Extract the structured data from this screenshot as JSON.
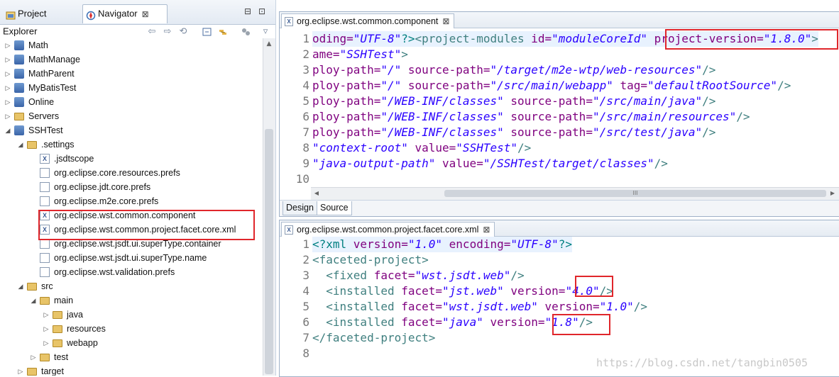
{
  "navigator": {
    "tabs": [
      {
        "label": "Project Explorer",
        "icon": "project-explorer-icon"
      },
      {
        "label": "Navigator",
        "icon": "navigator-icon",
        "close": "⊠"
      }
    ],
    "window_controls": {
      "minimize": "⊟",
      "maximize": "⊡"
    },
    "toolbar_icons": [
      "back-icon",
      "forward-icon",
      "go-into-icon",
      "collapse-all-icon",
      "link-with-editor-icon",
      "working-sets-icon",
      "view-menu-icon"
    ],
    "tree": [
      {
        "label": "Math",
        "depth": 0,
        "type": "project",
        "expander": "▷"
      },
      {
        "label": "MathManage",
        "depth": 0,
        "type": "project",
        "expander": "▷"
      },
      {
        "label": "MathParent",
        "depth": 0,
        "type": "project",
        "expander": "▷"
      },
      {
        "label": "MyBatisTest",
        "depth": 0,
        "type": "project",
        "expander": "▷"
      },
      {
        "label": "Online",
        "depth": 0,
        "type": "project",
        "expander": "▷"
      },
      {
        "label": "Servers",
        "depth": 0,
        "type": "folder",
        "expander": "▷"
      },
      {
        "label": "SSHTest",
        "depth": 0,
        "type": "project",
        "expander": "◢"
      },
      {
        "label": ".settings",
        "depth": 1,
        "type": "folder",
        "expander": "◢"
      },
      {
        "label": ".jsdtscope",
        "depth": 2,
        "type": "xmlfile",
        "expander": ""
      },
      {
        "label": "org.eclipse.core.resources.prefs",
        "depth": 2,
        "type": "file",
        "expander": ""
      },
      {
        "label": "org.eclipse.jdt.core.prefs",
        "depth": 2,
        "type": "file",
        "expander": ""
      },
      {
        "label": "org.eclipse.m2e.core.prefs",
        "depth": 2,
        "type": "file",
        "expander": ""
      },
      {
        "label": "org.eclipse.wst.common.component",
        "depth": 2,
        "type": "xmlfile",
        "expander": ""
      },
      {
        "label": "org.eclipse.wst.common.project.facet.core.xml",
        "depth": 2,
        "type": "xmlfile",
        "expander": ""
      },
      {
        "label": "org.eclipse.wst.jsdt.ui.superType.container",
        "depth": 2,
        "type": "file",
        "expander": ""
      },
      {
        "label": "org.eclipse.wst.jsdt.ui.superType.name",
        "depth": 2,
        "type": "file",
        "expander": ""
      },
      {
        "label": "org.eclipse.wst.validation.prefs",
        "depth": 2,
        "type": "file",
        "expander": ""
      },
      {
        "label": "src",
        "depth": 1,
        "type": "folder",
        "expander": "◢"
      },
      {
        "label": "main",
        "depth": 2,
        "type": "folder",
        "expander": "◢"
      },
      {
        "label": "java",
        "depth": 3,
        "type": "folder",
        "expander": "▷"
      },
      {
        "label": "resources",
        "depth": 3,
        "type": "folder",
        "expander": "▷"
      },
      {
        "label": "webapp",
        "depth": 3,
        "type": "folder",
        "expander": "▷"
      },
      {
        "label": "test",
        "depth": 2,
        "type": "folder",
        "expander": "▷"
      },
      {
        "label": "target",
        "depth": 1,
        "type": "folder",
        "expander": "▷"
      }
    ]
  },
  "editor1": {
    "tab_label": "org.eclipse.wst.common.component",
    "tab_close": "⊠",
    "line_numbers": [
      "1",
      "2",
      "3",
      "4",
      "5",
      "6",
      "7",
      "8",
      "9",
      "10"
    ],
    "lines": [
      [
        {
          "t": "oding=",
          "c": "attr"
        },
        {
          "t": "\"UTF-8\"",
          "c": "val"
        },
        {
          "t": "?>",
          "c": "pi"
        },
        {
          "t": "<project-modules ",
          "c": "tag"
        },
        {
          "t": "id=",
          "c": "attr"
        },
        {
          "t": "\"moduleCoreId\"",
          "c": "val"
        },
        {
          "t": " ",
          "c": "plain"
        },
        {
          "t": "project-version=",
          "c": "attr"
        },
        {
          "t": "\"1.8.0\"",
          "c": "val"
        },
        {
          "t": ">",
          "c": "tag"
        }
      ],
      [
        {
          "t": "ame=",
          "c": "attr"
        },
        {
          "t": "\"SSHTest\"",
          "c": "val"
        },
        {
          "t": ">",
          "c": "tag"
        }
      ],
      [
        {
          "t": "ploy-path=",
          "c": "attr"
        },
        {
          "t": "\"/\"",
          "c": "val"
        },
        {
          "t": " source-path=",
          "c": "attr"
        },
        {
          "t": "\"/target/m2e-wtp/web-resources\"",
          "c": "val"
        },
        {
          "t": "/>",
          "c": "tag"
        }
      ],
      [
        {
          "t": "ploy-path=",
          "c": "attr"
        },
        {
          "t": "\"/\"",
          "c": "val"
        },
        {
          "t": " source-path=",
          "c": "attr"
        },
        {
          "t": "\"/src/main/webapp\"",
          "c": "val"
        },
        {
          "t": " tag=",
          "c": "attr"
        },
        {
          "t": "\"defaultRootSource\"",
          "c": "val"
        },
        {
          "t": "/>",
          "c": "tag"
        }
      ],
      [
        {
          "t": "ploy-path=",
          "c": "attr"
        },
        {
          "t": "\"/WEB-INF/classes\"",
          "c": "val"
        },
        {
          "t": " source-path=",
          "c": "attr"
        },
        {
          "t": "\"/src/main/java\"",
          "c": "val"
        },
        {
          "t": "/>",
          "c": "tag"
        }
      ],
      [
        {
          "t": "ploy-path=",
          "c": "attr"
        },
        {
          "t": "\"/WEB-INF/classes\"",
          "c": "val"
        },
        {
          "t": " source-path=",
          "c": "attr"
        },
        {
          "t": "\"/src/main/resources\"",
          "c": "val"
        },
        {
          "t": "/>",
          "c": "tag"
        }
      ],
      [
        {
          "t": "ploy-path=",
          "c": "attr"
        },
        {
          "t": "\"/WEB-INF/classes\"",
          "c": "val"
        },
        {
          "t": " source-path=",
          "c": "attr"
        },
        {
          "t": "\"/src/test/java\"",
          "c": "val"
        },
        {
          "t": "/>",
          "c": "tag"
        }
      ],
      [
        {
          "t": "\"context-root\"",
          "c": "val"
        },
        {
          "t": " value=",
          "c": "attr"
        },
        {
          "t": "\"SSHTest\"",
          "c": "val"
        },
        {
          "t": "/>",
          "c": "tag"
        }
      ],
      [
        {
          "t": "\"java-output-path\"",
          "c": "val"
        },
        {
          "t": " value=",
          "c": "attr"
        },
        {
          "t": "\"/SSHTest/target/classes\"",
          "c": "val"
        },
        {
          "t": "/>",
          "c": "tag"
        }
      ],
      []
    ],
    "hscroll_grip": "III",
    "bottom_tabs": [
      "Design",
      "Source"
    ]
  },
  "editor2": {
    "tab_label": "org.eclipse.wst.common.project.facet.core.xml",
    "tab_close": "⊠",
    "line_numbers": [
      "1",
      "2",
      "3",
      "4",
      "5",
      "6",
      "7",
      "8"
    ],
    "lines": [
      [
        {
          "t": "<?xml ",
          "c": "pi"
        },
        {
          "t": "version=",
          "c": "attr"
        },
        {
          "t": "\"1.0\"",
          "c": "val"
        },
        {
          "t": " encoding=",
          "c": "attr"
        },
        {
          "t": "\"UTF-8\"",
          "c": "val"
        },
        {
          "t": "?>",
          "c": "pi"
        }
      ],
      [
        {
          "t": "<faceted-project>",
          "c": "tag"
        }
      ],
      [
        {
          "t": "  <fixed ",
          "c": "tag"
        },
        {
          "t": "facet=",
          "c": "attr"
        },
        {
          "t": "\"wst.jsdt.web\"",
          "c": "val"
        },
        {
          "t": "/>",
          "c": "tag"
        }
      ],
      [
        {
          "t": "  <installed ",
          "c": "tag"
        },
        {
          "t": "facet=",
          "c": "attr"
        },
        {
          "t": "\"jst.web\"",
          "c": "val"
        },
        {
          "t": " version=",
          "c": "attr"
        },
        {
          "t": "\"4.0\"",
          "c": "val"
        },
        {
          "t": "/>",
          "c": "tag"
        }
      ],
      [
        {
          "t": "  <installed ",
          "c": "tag"
        },
        {
          "t": "facet=",
          "c": "attr"
        },
        {
          "t": "\"wst.jsdt.web\"",
          "c": "val"
        },
        {
          "t": " version=",
          "c": "attr"
        },
        {
          "t": "\"1.0\"",
          "c": "val"
        },
        {
          "t": "/>",
          "c": "tag"
        }
      ],
      [
        {
          "t": "  <installed ",
          "c": "tag"
        },
        {
          "t": "facet=",
          "c": "attr"
        },
        {
          "t": "\"java\"",
          "c": "val"
        },
        {
          "t": " version=",
          "c": "attr"
        },
        {
          "t": "\"1.8\"",
          "c": "val"
        },
        {
          "t": "/>",
          "c": "tag"
        }
      ],
      [
        {
          "t": "</faceted-project>",
          "c": "tag"
        }
      ],
      []
    ]
  },
  "watermark": "https://blog.csdn.net/tangbin0505",
  "colors": {
    "highlight_box": "#e0262b",
    "xml_tag": "#3f7f7f",
    "xml_attr": "#7f007f",
    "xml_value": "#2a00ff",
    "line_number": "#787878",
    "current_line": "#e8f2fe"
  }
}
